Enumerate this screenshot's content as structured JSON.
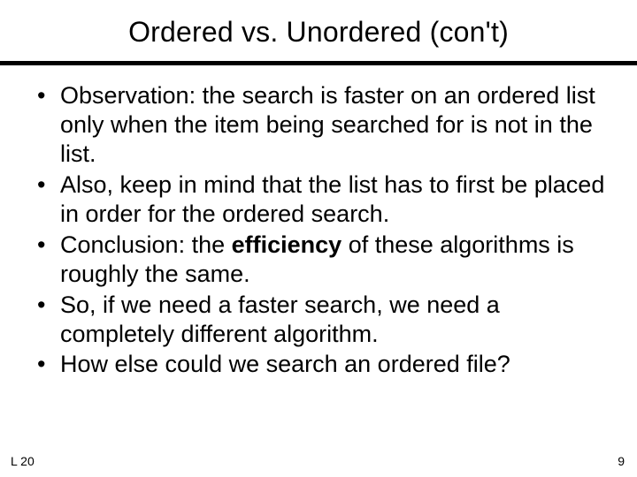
{
  "title": "Ordered vs. Unordered (con't)",
  "bullets": {
    "b0a": "Observation:  the search is faster on an ordered list only when the item being searched for is not in the list.",
    "b1a": "Also, keep in mind that the list has to first be placed in order for the ordered search.",
    "b2a": "Conclusion:  the ",
    "b2b": "efficiency",
    "b2c": " of these algorithms is roughly the same.",
    "b3a": "So, if we need a faster search, we need a completely different algorithm.",
    "b4a": "How else could we search an ordered file?"
  },
  "footer": {
    "left": "L 20",
    "right": "9"
  }
}
